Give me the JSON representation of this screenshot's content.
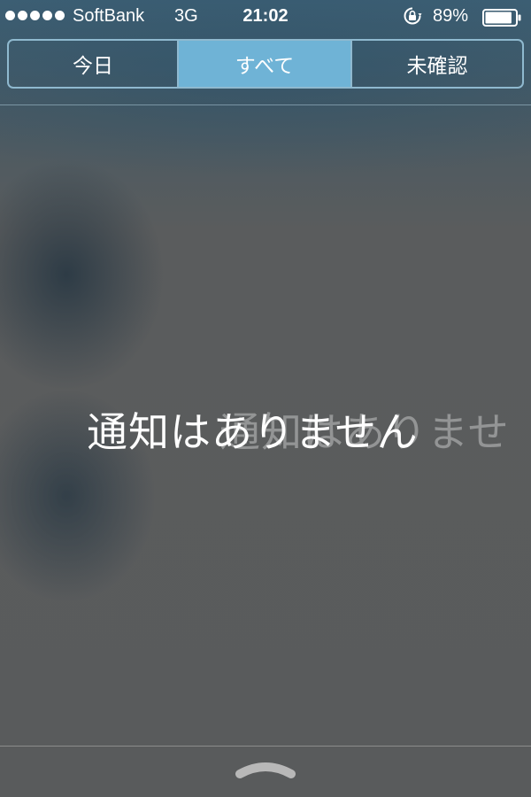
{
  "status_bar": {
    "signal_bars": 5,
    "carrier": "SoftBank",
    "network": "3G",
    "time": "21:02",
    "battery_percent": "89%",
    "battery_level": 0.89,
    "icons": [
      "signal-dots-icon",
      "rotation-lock-icon",
      "battery-icon"
    ]
  },
  "tabs": [
    {
      "label": "今日",
      "selected": false
    },
    {
      "label": "すべて",
      "selected": true
    },
    {
      "label": "未確認",
      "selected": false
    }
  ],
  "main": {
    "empty_message": "通知はありません",
    "empty_message_ghost": "通知はありませ"
  },
  "bottom": {
    "grabber_icon": "chevron-up-icon"
  },
  "colors": {
    "accent": "#6fb3d6",
    "tab_border": "#8fb9cf",
    "text": "#ffffff"
  }
}
